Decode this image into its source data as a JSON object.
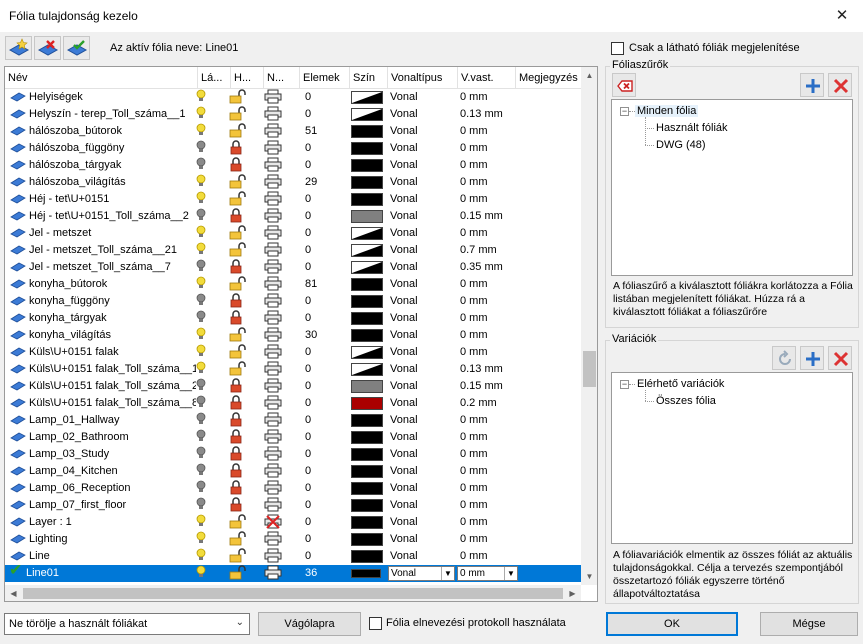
{
  "window": {
    "title": "Fólia tulajdonság kezelo",
    "close_glyph": "✕"
  },
  "toolbar": {
    "active_layer_text": "Az aktív fólia neve: Line01",
    "buttons": [
      "new-layer-icon",
      "delete-layer-icon",
      "purge-layer-icon"
    ]
  },
  "table": {
    "columns": [
      "Név",
      "Lá...",
      "H...",
      "N...",
      "Elemek",
      "Szín",
      "Vonaltípus",
      "V.vast.",
      "Megjegyzés"
    ],
    "rows": [
      {
        "name": "Helyiségek",
        "visible": true,
        "locked": false,
        "print": true,
        "count": "0",
        "color": "tri",
        "linetype": "Vonal",
        "width": "0 mm"
      },
      {
        "name": "Helyszín - terep_Toll_száma__1",
        "visible": true,
        "locked": false,
        "print": true,
        "count": "0",
        "color": "tri",
        "linetype": "Vonal",
        "width": "0.13 mm"
      },
      {
        "name": "hálószoba_bútorok",
        "visible": true,
        "locked": false,
        "print": true,
        "count": "51",
        "color": "#000000",
        "linetype": "Vonal",
        "width": "0 mm"
      },
      {
        "name": "hálószoba_függöny",
        "visible": false,
        "locked": true,
        "print": true,
        "count": "0",
        "color": "#000000",
        "linetype": "Vonal",
        "width": "0 mm"
      },
      {
        "name": "hálószoba_tárgyak",
        "visible": false,
        "locked": true,
        "print": true,
        "count": "0",
        "color": "#000000",
        "linetype": "Vonal",
        "width": "0 mm"
      },
      {
        "name": "hálószoba_világítás",
        "visible": true,
        "locked": false,
        "print": true,
        "count": "29",
        "color": "#000000",
        "linetype": "Vonal",
        "width": "0 mm"
      },
      {
        "name": "Héj - tet\\U+0151",
        "visible": true,
        "locked": false,
        "print": true,
        "count": "0",
        "color": "#000000",
        "linetype": "Vonal",
        "width": "0 mm"
      },
      {
        "name": "Héj - tet\\U+0151_Toll_száma__2",
        "visible": false,
        "locked": true,
        "print": true,
        "count": "0",
        "color": "#808080",
        "linetype": "Vonal",
        "width": "0.15 mm"
      },
      {
        "name": "Jel - metszet",
        "visible": true,
        "locked": false,
        "print": true,
        "count": "0",
        "color": "tri",
        "linetype": "Vonal",
        "width": "0 mm"
      },
      {
        "name": "Jel - metszet_Toll_száma__21",
        "visible": true,
        "locked": false,
        "print": true,
        "count": "0",
        "color": "tri",
        "linetype": "Vonal",
        "width": "0.7 mm"
      },
      {
        "name": "Jel - metszet_Toll_száma__7",
        "visible": false,
        "locked": true,
        "print": true,
        "count": "0",
        "color": "tri",
        "linetype": "Vonal",
        "width": "0.35 mm"
      },
      {
        "name": "konyha_bútorok",
        "visible": true,
        "locked": false,
        "print": true,
        "count": "81",
        "color": "#000000",
        "linetype": "Vonal",
        "width": "0 mm"
      },
      {
        "name": "konyha_függöny",
        "visible": false,
        "locked": true,
        "print": true,
        "count": "0",
        "color": "#000000",
        "linetype": "Vonal",
        "width": "0 mm"
      },
      {
        "name": "konyha_tárgyak",
        "visible": false,
        "locked": true,
        "print": true,
        "count": "0",
        "color": "#000000",
        "linetype": "Vonal",
        "width": "0 mm"
      },
      {
        "name": "konyha_világítás",
        "visible": true,
        "locked": false,
        "print": true,
        "count": "30",
        "color": "#000000",
        "linetype": "Vonal",
        "width": "0 mm"
      },
      {
        "name": "Küls\\U+0151 falak",
        "visible": true,
        "locked": false,
        "print": true,
        "count": "0",
        "color": "tri",
        "linetype": "Vonal",
        "width": "0 mm"
      },
      {
        "name": "Küls\\U+0151 falak_Toll_száma__1",
        "visible": true,
        "locked": false,
        "print": true,
        "count": "0",
        "color": "tri",
        "linetype": "Vonal",
        "width": "0.13 mm"
      },
      {
        "name": "Küls\\U+0151 falak_Toll_száma__2",
        "visible": false,
        "locked": true,
        "print": true,
        "count": "0",
        "color": "#808080",
        "linetype": "Vonal",
        "width": "0.15 mm"
      },
      {
        "name": "Küls\\U+0151 falak_Toll_száma__8",
        "visible": false,
        "locked": true,
        "print": true,
        "count": "0",
        "color": "#aa0000",
        "linetype": "Vonal",
        "width": "0.2 mm"
      },
      {
        "name": "Lamp_01_Hallway",
        "visible": false,
        "locked": true,
        "print": true,
        "count": "0",
        "color": "#000000",
        "linetype": "Vonal",
        "width": "0 mm"
      },
      {
        "name": "Lamp_02_Bathroom",
        "visible": false,
        "locked": true,
        "print": true,
        "count": "0",
        "color": "#000000",
        "linetype": "Vonal",
        "width": "0 mm"
      },
      {
        "name": "Lamp_03_Study",
        "visible": false,
        "locked": true,
        "print": true,
        "count": "0",
        "color": "#000000",
        "linetype": "Vonal",
        "width": "0 mm"
      },
      {
        "name": "Lamp_04_Kitchen",
        "visible": false,
        "locked": true,
        "print": true,
        "count": "0",
        "color": "#000000",
        "linetype": "Vonal",
        "width": "0 mm"
      },
      {
        "name": "Lamp_06_Reception",
        "visible": false,
        "locked": true,
        "print": true,
        "count": "0",
        "color": "#000000",
        "linetype": "Vonal",
        "width": "0 mm"
      },
      {
        "name": "Lamp_07_first_floor",
        "visible": false,
        "locked": true,
        "print": true,
        "count": "0",
        "color": "#000000",
        "linetype": "Vonal",
        "width": "0 mm"
      },
      {
        "name": "Layer : 1",
        "visible": true,
        "locked": false,
        "print": false,
        "count": "0",
        "color": "#000000",
        "linetype": "Vonal",
        "width": "0 mm"
      },
      {
        "name": "Lighting",
        "visible": true,
        "locked": false,
        "print": true,
        "count": "0",
        "color": "#000000",
        "linetype": "Vonal",
        "width": "0 mm"
      },
      {
        "name": "Line",
        "visible": true,
        "locked": false,
        "print": true,
        "count": "0",
        "color": "#000000",
        "linetype": "Vonal",
        "width": "0 mm"
      },
      {
        "name": "Line01",
        "visible": true,
        "locked": false,
        "print": true,
        "count": "36",
        "color": "#000000",
        "linetype": "Vonal",
        "width": "0 mm",
        "selected": true
      }
    ]
  },
  "right": {
    "show_visible_only_label": "Csak a látható fóliák megjelenítése",
    "filters": {
      "title": "Fóliaszűrők",
      "tree": {
        "root": "Minden fólia",
        "children": [
          "Használt fóliák",
          "DWG (48)"
        ]
      },
      "description": "A fóliaszűrő a kiválasztott fóliákra korlátozza a Fólia listában megjelenített fóliákat. Húzza rá a kiválasztott fóliákat a fóliaszűrőre"
    },
    "variations": {
      "title": "Variációk",
      "tree": {
        "root": "Elérhető variációk",
        "children": [
          "Összes fólia"
        ]
      },
      "description": "A fóliavariációk elmentik az összes fóliát az aktuális tulajdonságokkal. Célja a tervezés szempontjából összetartozó fóliák egyszerre történő állapotváltoztatása"
    }
  },
  "bottom": {
    "delete_combo_value": "Ne törölje a használt fóliákat",
    "clipboard_button": "Vágólapra",
    "naming_protocol_label": "Fólia elnevezési protokoll használata",
    "ok_button": "OK",
    "cancel_button": "Mégse"
  },
  "colors": {
    "selection": "#0078d7",
    "bulb_on": "#f2dc3c",
    "lock": "#f3c43b",
    "lock_closed": "#d33d2b",
    "add": "#2a6ec6",
    "remove": "#d33"
  }
}
